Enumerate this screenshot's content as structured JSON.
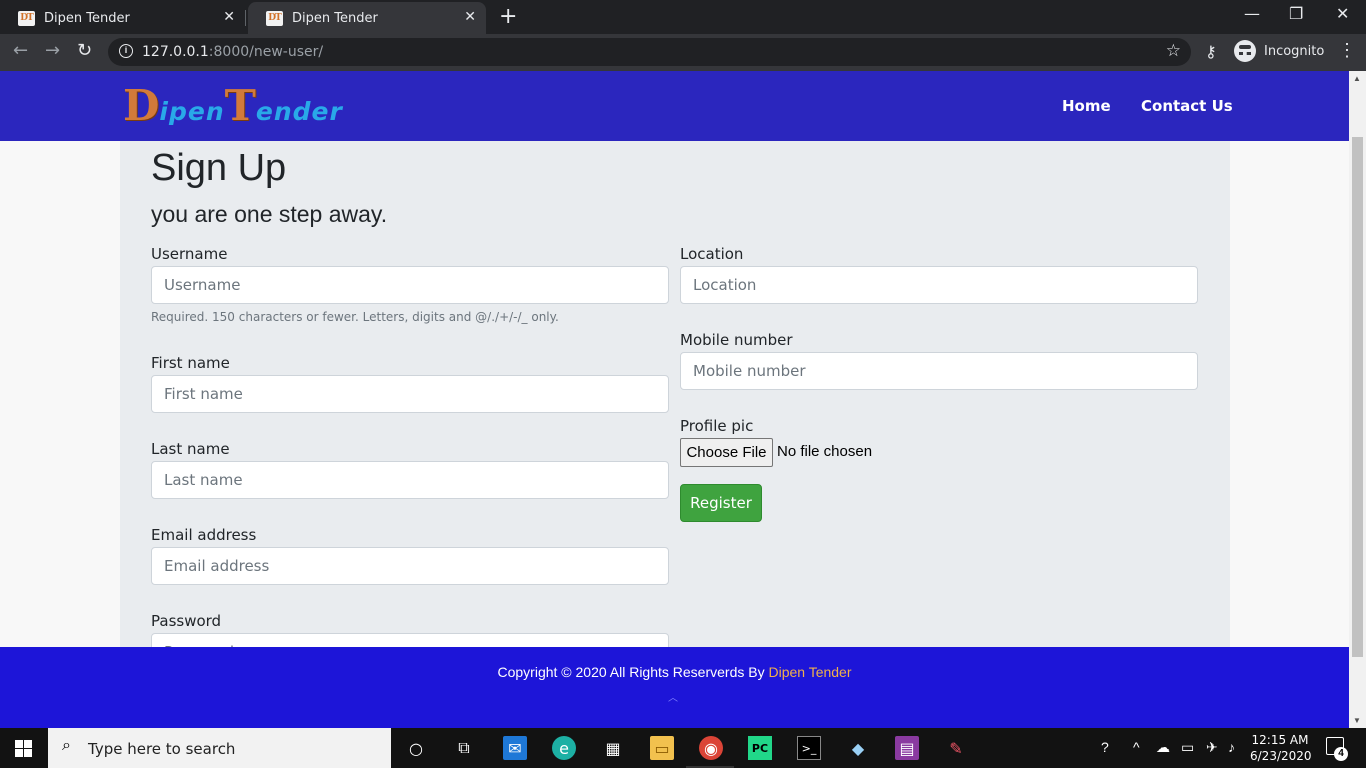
{
  "browser": {
    "tabs": [
      {
        "favicon": "DT",
        "title": "Dipen Tender",
        "close": "✕"
      },
      {
        "favicon": "DT",
        "title": "Dipen Tender",
        "close": "✕"
      }
    ],
    "new_tab": "+",
    "controls": {
      "minimize": "—",
      "maximize": "❐",
      "close": "✕"
    },
    "url_host": "127.0.0.1",
    "url_rest": ":8000/new-user/",
    "profile_label": "Incognito"
  },
  "nav": {
    "logo_d": "D",
    "logo_ipen": "ipen",
    "logo_t": "T",
    "logo_ender": "ender",
    "links": [
      "Home",
      "Contact Us"
    ]
  },
  "form": {
    "title": "Sign Up",
    "subtitle": "you are one step away.",
    "username": {
      "label": "Username",
      "placeholder": "Username",
      "help": "Required. 150 characters or fewer. Letters, digits and @/./+/-/_ only."
    },
    "first_name": {
      "label": "First name",
      "placeholder": "First name"
    },
    "last_name": {
      "label": "Last name",
      "placeholder": "Last name"
    },
    "email": {
      "label": "Email address",
      "placeholder": "Email address"
    },
    "password": {
      "label": "Password",
      "placeholder": "Password"
    },
    "location": {
      "label": "Location",
      "placeholder": "Location"
    },
    "mobile": {
      "label": "Mobile number",
      "placeholder": "Mobile number"
    },
    "profile_pic": {
      "label": "Profile pic",
      "button": "Choose File",
      "status": "No file chosen"
    },
    "submit": "Register"
  },
  "footer": {
    "text": "Copyright © 2020 All Rights Reserverds By ",
    "brand": "Dipen Tender"
  },
  "colors": {
    "navbar": "#2b26be",
    "footer": "#1d15d8",
    "register": "#3fa33f",
    "brand_orange": "#f0b04c"
  },
  "taskbar": {
    "search_placeholder": "Type here to search",
    "time": "12:15 AM",
    "date": "6/23/2020",
    "notification_count": "4",
    "apps": [
      "cortana-icon",
      "task-view-icon",
      "mail-icon",
      "edge-icon",
      "store-icon",
      "file-explorer-icon",
      "chrome-icon",
      "pycharm-icon",
      "terminal-icon",
      "app-icon",
      "winrar-icon",
      "paint-icon"
    ]
  }
}
